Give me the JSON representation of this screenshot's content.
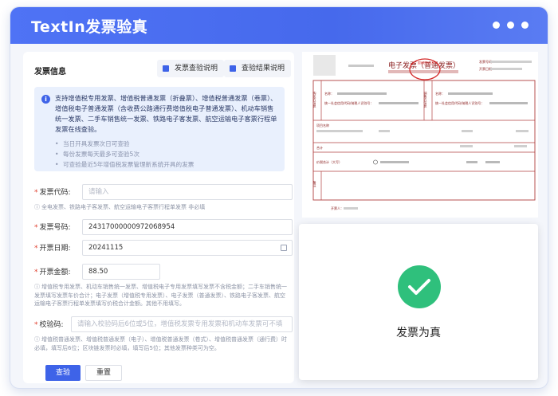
{
  "app": {
    "title": "TextIn发票验真"
  },
  "form": {
    "section_title": "发票信息",
    "tab_verify_guide": "发票查验说明",
    "tab_result_guide": "查验结果说明",
    "notice": {
      "main": "支持增值税专用发票、增值税普通发票（折叠票）、增值税普通发票（卷票）、增值税电子普通发票（含收费公路通行费增值税电子普通发票）、机动车销售统一发票、二手车销售统一发票、铁路电子客发票、航空运输电子客票行程单发票在线查验。",
      "bullets": [
        "当日开具发票次日可查验",
        "每份发票每天最多可查验5次",
        "可查验最近5年增值税发票管理新系统开具的发票"
      ]
    },
    "fields": {
      "invoice_code": {
        "label": "发票代码:",
        "placeholder": "请输入",
        "hint": "全电发票、铁路电子客发票、航空运输电子客票行程单发票 非必填"
      },
      "invoice_number": {
        "label": "发票号码:",
        "value": "24317000000972068954"
      },
      "issue_date": {
        "label": "开票日期:",
        "value": "20241115"
      },
      "amount": {
        "label": "开票金额:",
        "value": "88.50",
        "hint": "增值税专用发票、机动车销售统一发票、增值税电子专用发票填写发票不含税金额；二手车销售统一发票填写发票车价合计；电子发票（增值税专用发票）、电子发票（普通发票）、铁路电子客发票、航空运输电子客票行程单发票填写价税合计金额。其他不用填写。"
      },
      "check_code": {
        "label": "校验码:",
        "placeholder": "请输入校验码后6位或5位，增值税发票专用发票和机动车发票可不填",
        "hint": "增值税普通发票、增值税普通发票（电子）、增值税普通发票（卷式）、增值税普通发票（通行费）时必填，填写后6位；区块链发票时必填，填写后5位；其他发票种类可为空。"
      }
    },
    "query_button": "查验",
    "reset_button": "重置"
  },
  "invoice_preview": {
    "title": "电子发票（普通发票）",
    "seal_text": "国家税务总局",
    "invoice_no_label": "发票号码：",
    "issue_date_label": "开票日期：",
    "buyer_label": "购买方信息",
    "seller_label": "销售方信息",
    "name_label": "名称：",
    "tax_id_label": "统一社会信用代码/纳税人识别号：",
    "item_header": "项目名称",
    "total_label": "合计",
    "amount_label": "价税合计（大写）",
    "remarks_label": "备注",
    "issuer_label": "开票人："
  },
  "result": {
    "text": "发票为真",
    "icon": "check-icon",
    "color": "#2fc07c"
  }
}
